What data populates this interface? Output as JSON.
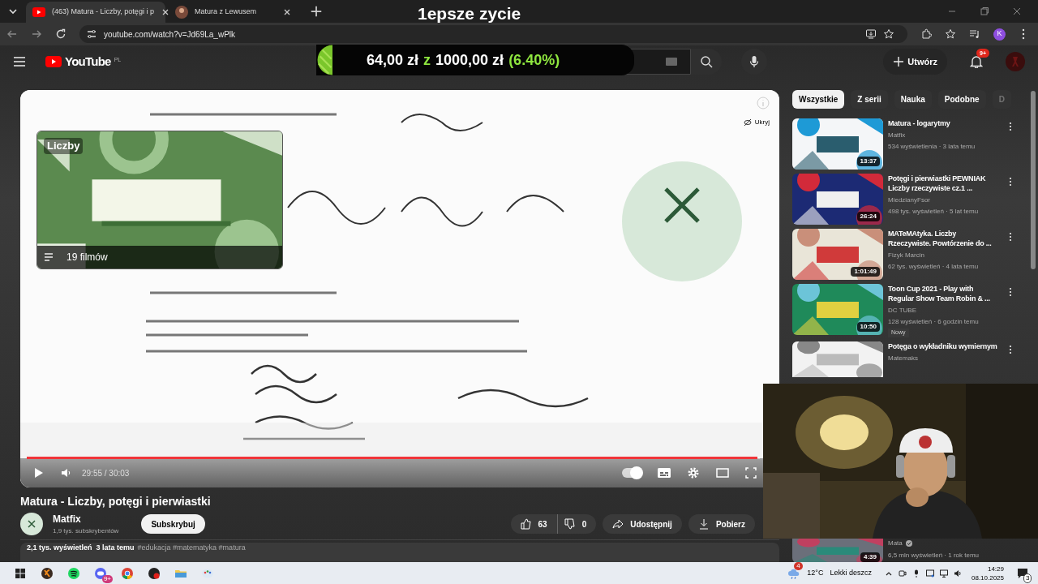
{
  "browser": {
    "tabs": [
      {
        "title": "(463) Matura - Liczby, potęgi i p",
        "selected": true
      },
      {
        "title": "Matura z Lewusem",
        "selected": false
      }
    ],
    "url": "youtube.com/watch?v=Jd69La_wPlk",
    "profile_initial": "K"
  },
  "stream_overlay": {
    "title": "1epsze zycie",
    "goal": {
      "current": "64,00 zł",
      "separator": "z",
      "target": "1000,00 zł",
      "percent": "(6.40%)"
    }
  },
  "header": {
    "logo_text": "YouTube",
    "region": "PL",
    "create_button": "Utwórz",
    "notifications_badge": "9+"
  },
  "player": {
    "end_card": {
      "title": "Liczby",
      "count": "19 filmów"
    },
    "hide_button": "Ukryj",
    "time": "29:55 / 30:03",
    "level": 0.997,
    "autoplay": true
  },
  "video": {
    "title": "Matura - Liczby, potęgi i pierwiastki",
    "channel": "Matfix",
    "subscribers": "1,9 tys. subskrybentów",
    "subscribe_button": "Subskrybuj",
    "likes": "63",
    "dislikes": "0",
    "share": "Udostępnij",
    "download": "Pobierz",
    "stats": "2,1 tys. wyświetleń  3 lata temu",
    "tags": "#edukacja #matematyka #matura"
  },
  "chips": [
    {
      "label": "Wszystkie",
      "selected": true
    },
    {
      "label": "Z serii",
      "selected": false
    },
    {
      "label": "Nauka",
      "selected": false
    },
    {
      "label": "Podobne",
      "selected": false
    },
    {
      "label": "D",
      "selected": false
    }
  ],
  "recommendations": [
    {
      "title": "Matura - logarytmy",
      "channel": "Matfix",
      "meta": "534 wyświetlenia · 3 lata temu",
      "duration": "13:37"
    },
    {
      "title": "Potęgi i pierwiastki PEWNIAK Liczby rzeczywiste cz.1 ...",
      "channel": "MiedzianyFsor",
      "meta": "498 tys. wyświetleń · 5 lat temu",
      "duration": "26:24"
    },
    {
      "title": "MATeMAtyka. Liczby Rzeczywiste. Powtórzenie do ...",
      "channel": "Fizyk Marcin",
      "meta": "62 tys. wyświetleń · 4 lata temu",
      "duration": "1:01:49"
    },
    {
      "title": "Toon Cup 2021 - Play with Regular Show Team Robin & ...",
      "channel": "DC TUBE",
      "meta": "128 wyświetleń · 6 godzin temu",
      "duration": "10:50",
      "badge": "Nowy"
    },
    {
      "title": "Potęga o wykładniku wymiernym",
      "channel": "Matemaks"
    }
  ],
  "last_recommendation": {
    "channel": "Mata",
    "verified": true,
    "meta": "6,5 mln wyświetleń · 1 rok temu",
    "duration": "4:39"
  },
  "taskbar": {
    "apps": [
      {
        "kind": "start"
      },
      {
        "kind": "fruit"
      },
      {
        "kind": "music"
      },
      {
        "kind": "chat",
        "badge": "9+"
      },
      {
        "kind": "browser"
      },
      {
        "kind": "record"
      },
      {
        "kind": "folder"
      },
      {
        "kind": "paint"
      }
    ],
    "weather_badge": "4",
    "temperature": "12°C",
    "weather": "Lekki deszcz",
    "time": "14:29",
    "date": "08.10.2025",
    "notifications": "3"
  }
}
